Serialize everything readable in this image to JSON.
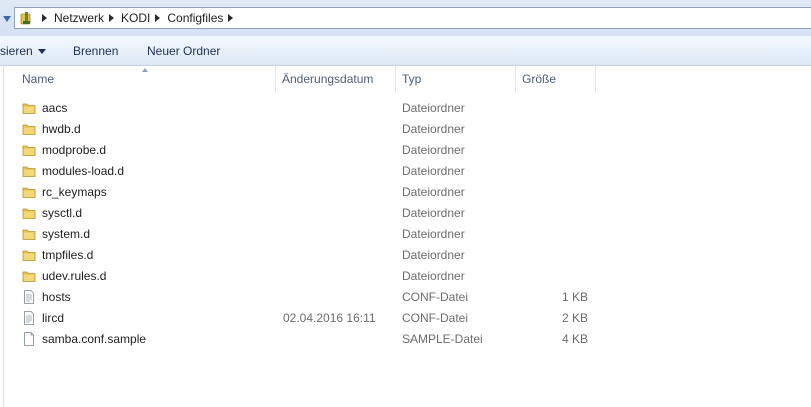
{
  "breadcrumb": {
    "root_icon": "network-folder-icon",
    "items": [
      "Netzwerk",
      "KODI",
      "Configfiles"
    ]
  },
  "commandbar": {
    "organize_label": "sieren",
    "burn_label": "Brennen",
    "new_folder_label": "Neuer Ordner"
  },
  "columns": {
    "name": "Name",
    "date": "Änderungsdatum",
    "type": "Typ",
    "size": "Größe"
  },
  "files": [
    {
      "name": "aacs",
      "date": "",
      "type": "Dateiordner",
      "size": "",
      "icon": "folder-icon"
    },
    {
      "name": "hwdb.d",
      "date": "",
      "type": "Dateiordner",
      "size": "",
      "icon": "folder-icon"
    },
    {
      "name": "modprobe.d",
      "date": "",
      "type": "Dateiordner",
      "size": "",
      "icon": "folder-icon"
    },
    {
      "name": "modules-load.d",
      "date": "",
      "type": "Dateiordner",
      "size": "",
      "icon": "folder-icon"
    },
    {
      "name": "rc_keymaps",
      "date": "",
      "type": "Dateiordner",
      "size": "",
      "icon": "folder-icon"
    },
    {
      "name": "sysctl.d",
      "date": "",
      "type": "Dateiordner",
      "size": "",
      "icon": "folder-icon"
    },
    {
      "name": "system.d",
      "date": "",
      "type": "Dateiordner",
      "size": "",
      "icon": "folder-icon"
    },
    {
      "name": "tmpfiles.d",
      "date": "",
      "type": "Dateiordner",
      "size": "",
      "icon": "folder-icon"
    },
    {
      "name": "udev.rules.d",
      "date": "",
      "type": "Dateiordner",
      "size": "",
      "icon": "folder-icon"
    },
    {
      "name": "hosts",
      "date": "",
      "type": "CONF-Datei",
      "size": "1 KB",
      "icon": "text-file-icon"
    },
    {
      "name": "lircd",
      "date": "02.04.2016 16:11",
      "type": "CONF-Datei",
      "size": "2 KB",
      "icon": "text-file-icon"
    },
    {
      "name": "samba.conf.sample",
      "date": "",
      "type": "SAMPLE-Datei",
      "size": "4 KB",
      "icon": "blank-file-icon"
    }
  ],
  "colors": {
    "folder": "#e8c14a",
    "accent": "#3c6aa8",
    "secondary_text": "#6d6d6d"
  }
}
